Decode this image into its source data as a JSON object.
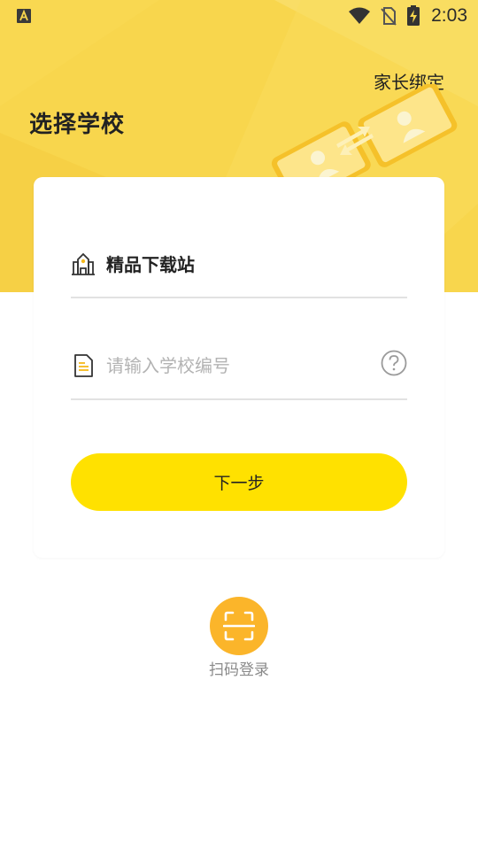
{
  "status_bar": {
    "time": "2:03",
    "left_icon": "keyboard-a-icon",
    "icons": [
      "wifi-icon",
      "no-sim-icon",
      "battery-charging-icon"
    ]
  },
  "header": {
    "title": "选择学校",
    "parent_bind_label": "家长绑定",
    "background_color": "#f8d64d",
    "illustration": "phones-exchange-illustration"
  },
  "form": {
    "school_icon": "school-building-icon",
    "school_name": "精品下载站",
    "code_icon": "document-icon",
    "code_placeholder": "请输入学校编号",
    "code_value": "",
    "help_icon": "question-circle-icon",
    "next_button_label": "下一步",
    "next_button_color": "#ffe100"
  },
  "scan_login": {
    "icon": "scan-frame-icon",
    "label": "扫码登录",
    "color": "#fbb52a"
  }
}
